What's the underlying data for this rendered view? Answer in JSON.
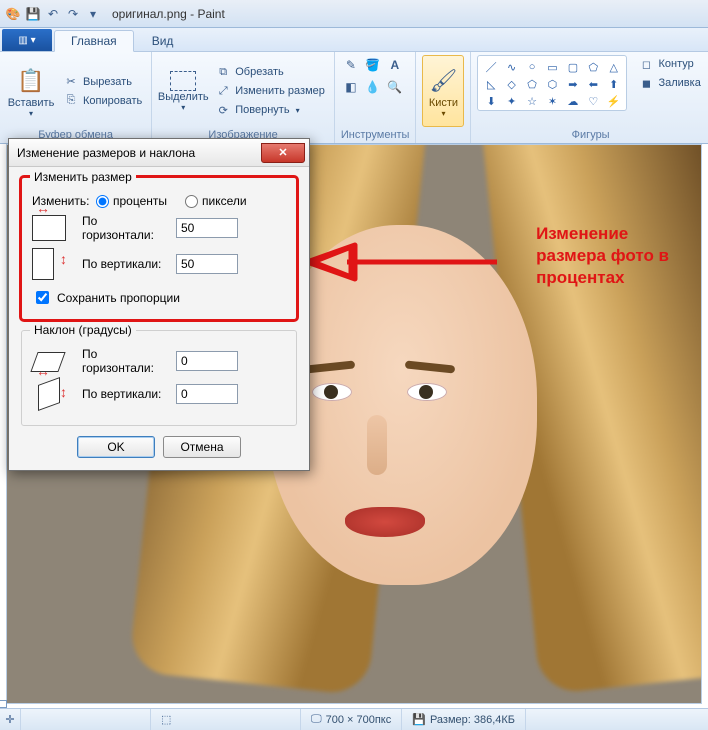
{
  "titlebar": {
    "title": "оригинал.png - Paint"
  },
  "tabs": {
    "main": "Главная",
    "view": "Вид"
  },
  "ribbon": {
    "clipboard": {
      "label": "Буфер обмена",
      "paste": "Вставить",
      "cut": "Вырезать",
      "copy": "Копировать"
    },
    "image": {
      "label": "Изображение",
      "select": "Выделить",
      "crop": "Обрезать",
      "resize": "Изменить размер",
      "rotate": "Повернуть"
    },
    "tools": {
      "label": "Инструменты"
    },
    "brushes": {
      "label": "Кисти"
    },
    "shapes": {
      "label": "Фигуры",
      "outline": "Контур",
      "fill": "Заливка"
    }
  },
  "dialog": {
    "title": "Изменение размеров и наклона",
    "resize": {
      "legend": "Изменить размер",
      "by_label": "Изменить:",
      "percent": "проценты",
      "pixels": "пиксели",
      "horizontal": "По горизонтали:",
      "vertical": "По вертикали:",
      "h_value": "50",
      "v_value": "50",
      "keep_aspect": "Сохранить пропорции"
    },
    "skew": {
      "legend": "Наклон (градусы)",
      "horizontal": "По горизонтали:",
      "vertical": "По вертикали:",
      "h_value": "0",
      "v_value": "0"
    },
    "ok": "OK",
    "cancel": "Отмена"
  },
  "annotation": {
    "line1": "Изменение",
    "line2": "размера фото в",
    "line3": "процентах"
  },
  "status": {
    "dimensions": "700 × 700пкс",
    "size": "Размер: 386,4КБ"
  }
}
